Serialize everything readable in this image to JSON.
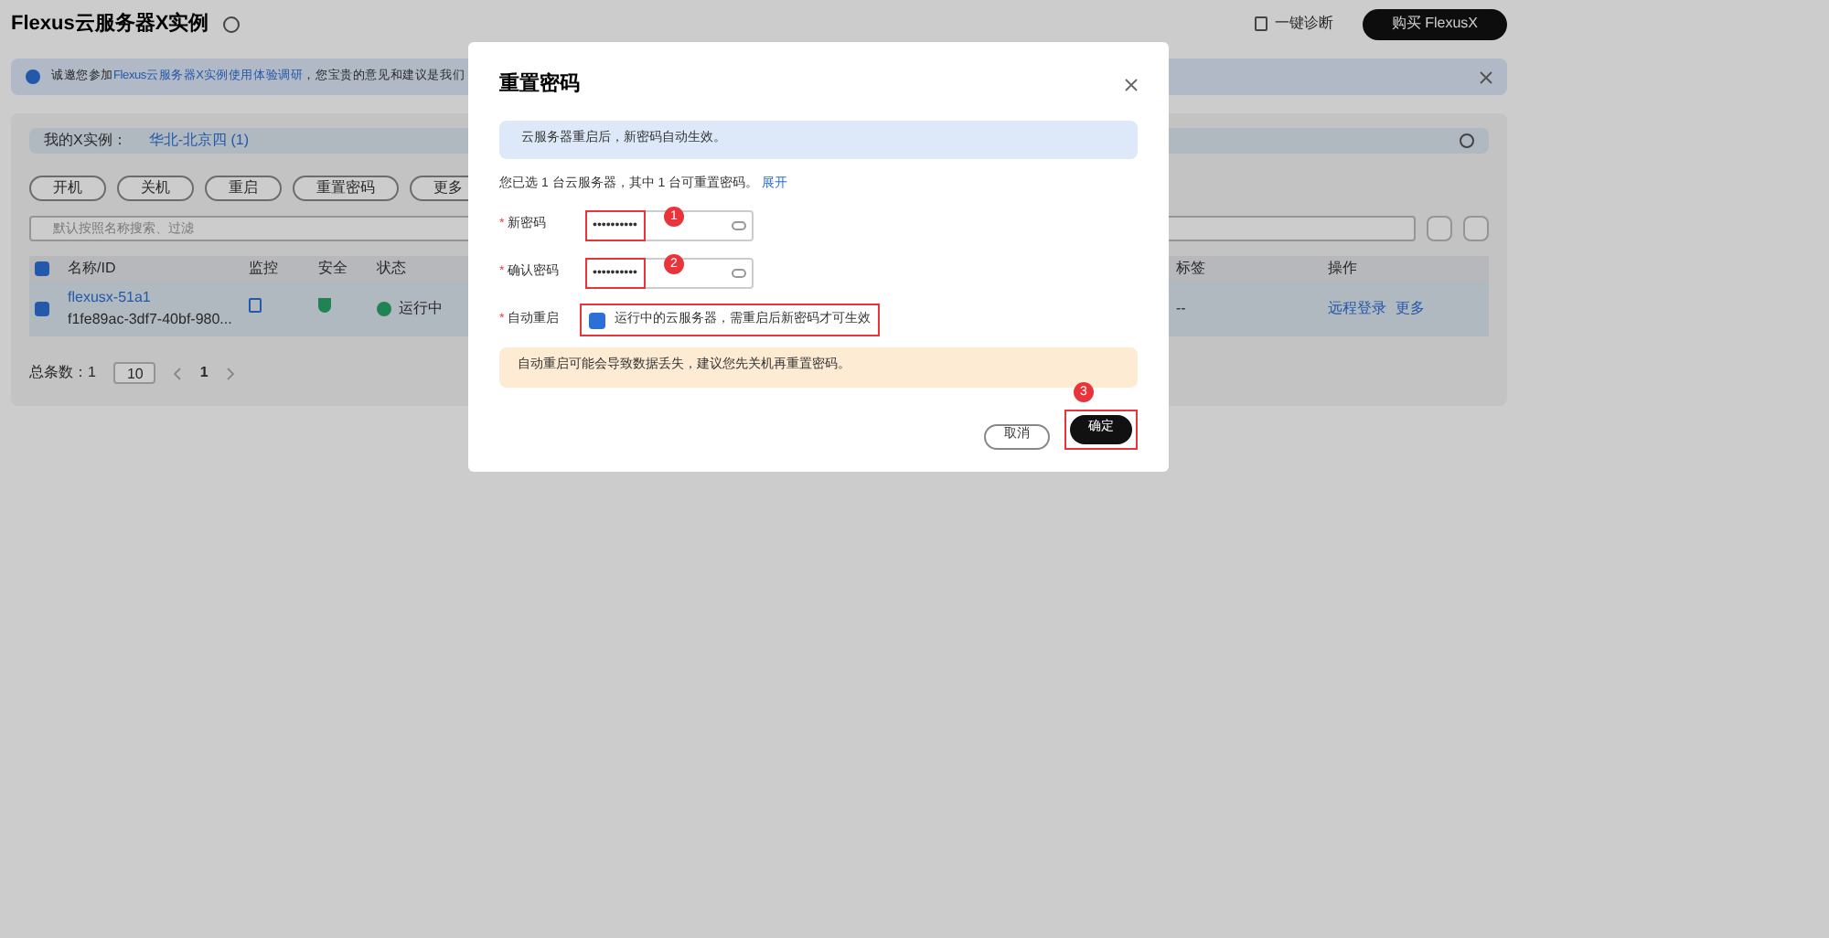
{
  "page": {
    "title": "Flexus云服务器X实例",
    "diagnose": "一键诊断",
    "buy": "购买 FlexusX"
  },
  "banner": {
    "prefix": "诚邀您参加",
    "link": "Flexus云服务器X实例使用体验调研",
    "suffix": "，您宝贵的意见和建议是我们"
  },
  "filter": {
    "label": "我的X实例：",
    "value": "华北-北京四 (1)"
  },
  "toolbar": [
    "开机",
    "关机",
    "重启",
    "重置密码",
    "更多"
  ],
  "search": {
    "placeholder": "默认按照名称搜索、过滤"
  },
  "table": {
    "all_selected": true,
    "columns": [
      "名称/ID",
      "监控",
      "安全",
      "状态",
      "标签",
      "操作"
    ],
    "rows": [
      {
        "selected": true,
        "name": "flexusx-51a1",
        "id": "f1fe89ac-3df7-40bf-980...",
        "status": "运行中",
        "tag": "--",
        "actions": [
          "远程登录",
          "更多"
        ]
      }
    ]
  },
  "pagination": {
    "total": "总条数：1",
    "page_size": "10",
    "pages": [
      {
        "label": "1",
        "selected": true
      }
    ]
  },
  "dialog": {
    "title": "重置密码",
    "info": "云服务器重启后，新密码自动生效。",
    "summary": "您已选 1 台云服务器，其中 1 台可重置密码。",
    "expand": "展开",
    "fields": [
      {
        "label": "新密码",
        "required": "*",
        "value": "••••••••••",
        "marker": "1"
      },
      {
        "label": "确认密码",
        "required": "*",
        "value": "••••••••••",
        "marker": "2"
      }
    ],
    "restart": {
      "label": "自动重启",
      "required": "*",
      "checked": true,
      "text": "运行中的云服务器，需重启后新密码才可生效"
    },
    "warning": "自动重启可能会导致数据丢失，建议您先关机再重置密码。",
    "cancel": "取消",
    "confirm": "确定",
    "confirm_marker": "3"
  }
}
